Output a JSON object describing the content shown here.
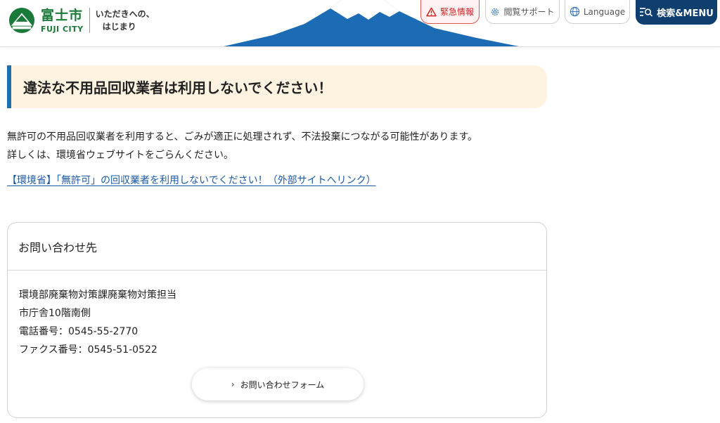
{
  "header": {
    "city_name": "富士市",
    "city_name_en": "FUJI CITY",
    "tagline_line1": "いただきへの、",
    "tagline_line2": "はじまり",
    "emergency_label": "緊急情報",
    "accessibility_label": "閲覧サポート",
    "language_label": "Language",
    "menu_label": "検索&MENU"
  },
  "main": {
    "heading": "違法な不用品回収業者は利用しないでください！",
    "paragraph_line1": "無許可の不用品回収業者を利用すると、ごみが適正に処理されず、不法投棄につながる可能性があります。",
    "paragraph_line2": "詳しくは、環境省ウェブサイトをごらんください。",
    "external_link": "【環境省】「無許可」の回収業者を利用しないでください！（外部サイトへリンク）"
  },
  "contact": {
    "title": "お問い合わせ先",
    "department": "環境部廃棄物対策課廃棄物対策担当",
    "location": "市庁舎10階南側",
    "phone": "電話番号：0545-55-2770",
    "fax": "ファクス番号：0545-51-0522",
    "form_button": "お問い合わせフォーム"
  },
  "colors": {
    "brand_green": "#1a7a3a",
    "accent_blue": "#1f6fa8",
    "menu_navy": "#0f3f6e",
    "emergency_red": "#d02020",
    "heading_bg": "#fdf3e0"
  },
  "icons": {
    "emergency": "warning-triangle-icon",
    "accessibility": "gear-icon",
    "language": "globe-icon",
    "menu": "search-menu-icon",
    "form_button": "chevron-right-icon"
  }
}
